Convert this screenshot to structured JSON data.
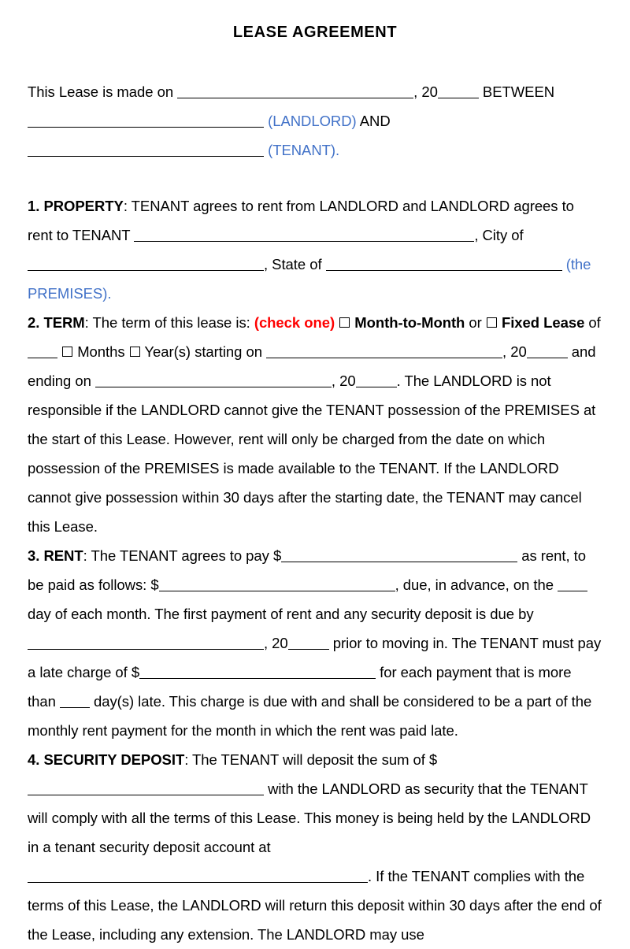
{
  "document": {
    "title": "LEASE AGREEMENT",
    "colors": {
      "blue_label": "#4272C8",
      "red_instruction": "#FF0000",
      "text": "#000000",
      "background": "#FFFFFF"
    }
  },
  "preamble": {
    "line1_a": "This Lease is made on ",
    "line1_b": ", 20",
    "line1_c": " BETWEEN",
    "line2_landlord_label": "(LANDLORD)",
    "line2_and": " AND ",
    "line2_tenant_label": "(TENANT)."
  },
  "sections": [
    {
      "number": "1.",
      "heading": "PROPERTY",
      "colon": ":",
      "t1": " TENANT agrees to rent from LANDLORD and LANDLORD agrees to rent to TENANT ",
      "t2": ", City of ",
      "t3": ", State of ",
      "premises_label": "(the PREMISES)."
    },
    {
      "number": "2.",
      "heading": "TERM",
      "colon": ":",
      "t1": " The term of this lease is: ",
      "check_one": "(check one)",
      "month_to_month": "Month-to-Month",
      "or": " or ",
      "fixed_lease": "Fixed Lease",
      "of": " of ",
      "months": "Months",
      "years": "Year(s)",
      "starting_on": " starting on ",
      "year_prefix_1": ", 20",
      "and_ending_on": " and ending on ",
      "year_prefix_2": ", 20",
      "tail": ". The LANDLORD is not responsible if the LANDLORD cannot give the TENANT possession of the PREMISES at the start of this Lease. However, rent will only be charged from the date on which possession of the PREMISES is made available to the TENANT. If the LANDLORD cannot give possession within 30 days after the starting date, the TENANT may cancel this Lease."
    },
    {
      "number": "3.",
      "heading": "RENT",
      "colon": ":",
      "t1": " The TENANT agrees to pay $",
      "t2": " as rent, to be paid as follows: $",
      "t3": ", due, in advance, on the ",
      "t4": " day of each month. The first payment of rent and any security deposit is due by ",
      "t5": ", 20",
      "t6": " prior to moving in. The TENANT must pay a late charge of $",
      "t7": " for each payment that is more than ",
      "t8": " day(s) late. This charge is due with and shall be considered to be a part of the monthly rent payment for the month in which the rent was paid late."
    },
    {
      "number": "4.",
      "heading": "SECURITY DEPOSIT",
      "colon": ":",
      "t1": " The TENANT will deposit the sum of $",
      "t2": " with the LANDLORD as security that the TENANT will comply with all the terms of this Lease. This money is being held by the LANDLORD in a tenant security deposit account at ",
      "t3": ". If the TENANT complies with the terms of this Lease, the LANDLORD will return this deposit within 30 days after the end of the Lease, including any extension. The LANDLORD may use"
    }
  ]
}
